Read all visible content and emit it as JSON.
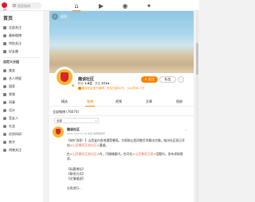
{
  "brand": {
    "logo_text": "微博"
  },
  "search": {
    "placeholder": "搜索微博"
  },
  "nav": {
    "icons": [
      "home-icon",
      "video-icon",
      "hot-icon",
      "game-icon"
    ]
  },
  "sidebar": {
    "title": "首页",
    "main_items": [
      {
        "label": "全部关注",
        "icon": "home-icon"
      },
      {
        "label": "最新微博",
        "icon": "clock-icon"
      },
      {
        "label": "特别关注",
        "icon": "star-icon"
      },
      {
        "label": "好友圈",
        "icon": "group-icon"
      }
    ],
    "section_title": "自定义分组",
    "group_items": [
      {
        "label": "美女",
        "icon": "user-icon"
      },
      {
        "label": "名人明星",
        "icon": "user-icon"
      },
      {
        "label": "国家",
        "icon": "user-icon"
      },
      {
        "label": "视频",
        "icon": "video-icon"
      },
      {
        "label": "同事",
        "icon": "user-icon"
      },
      {
        "label": "设计",
        "icon": "user-icon"
      },
      {
        "label": "室友人",
        "icon": "user-icon"
      },
      {
        "label": "社会",
        "icon": "user-icon"
      },
      {
        "label": "优质科研",
        "icon": "user-icon"
      },
      {
        "label": "数字",
        "icon": "user-icon"
      },
      {
        "label": "明晓关注",
        "icon": "user-icon"
      }
    ]
  },
  "profile": {
    "banner_title": "返回",
    "avatar_text": "趣谈社区",
    "name": "趣谈社区",
    "fans_label": "粉丝",
    "fans_value": "1.8亿",
    "following_label": "关注",
    "following_value": "2714",
    "verified": "趣谈社区官方微博，好友已超50万，公众号30.7万",
    "follow_label": "+ 关注",
    "message_label": "私信",
    "more_label": "⋯"
  },
  "tabs": [
    {
      "label": "精选"
    },
    {
      "label": "微博",
      "active": true
    },
    {
      "label": "视频"
    },
    {
      "label": "文章"
    },
    {
      "label": "相册"
    }
  ],
  "feed": {
    "all_label": "全部微博 (76074)",
    "filter_label": "全部",
    "post": {
      "author": "趣谈社区",
      "meta": "2021-8-18 11:10 来自 微博视频号",
      "line1_pre": "【持扩消息！】山西省内多地遭受暴雨。为帮助山西同胞尽早解决灾情，临汾社区现已开启",
      "line1_link": "#山西暴雨互助社区#",
      "line1_post": "通道。",
      "line2_pre": "在",
      "line2_link": "#山西暴雨互助社区#",
      "line2_mid": "内，可随随意内，也可在",
      "line2_link2": "#山西暴雨互助#",
      "line2_post": "话题内，发布求助需求。",
      "field1": "【标题地址】",
      "field2": "【联系方式】",
      "field3": "【灾情描述】",
      "line3": "分类进行..."
    }
  },
  "colors": {
    "accent": "#ff8200",
    "brand": "#e6162d",
    "link": "#eb7350"
  }
}
